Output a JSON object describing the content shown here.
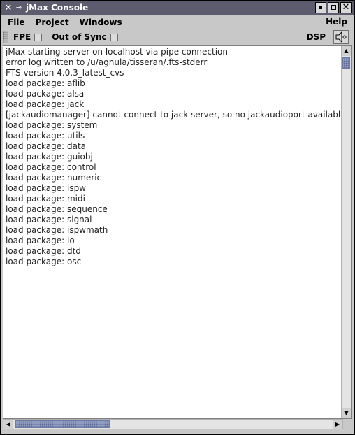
{
  "window": {
    "title": "jMax Console",
    "icons": {
      "app": "x-logo-icon",
      "pin": "pin-icon",
      "minimize": "minimize-icon",
      "maximize": "maximize-icon",
      "close": "close-icon"
    }
  },
  "menubar": {
    "items": [
      "File",
      "Project",
      "Windows"
    ],
    "help": "Help"
  },
  "toolbar": {
    "fpe_label": "FPE",
    "out_of_sync_label": "Out of Sync",
    "dsp_label": "DSP",
    "dsp_icon": "speaker-icon"
  },
  "console": {
    "lines": [
      "jMax starting server on localhost via pipe connection",
      "error log written to /u/agnula/tisseran/.fts-stderr",
      "FTS version 4.0.3_latest_cvs",
      "load package: aflib",
      "load package: alsa",
      "load package: jack",
      "[jackaudiomanager] cannot connect to jack server, so no jackaudioport available",
      "load package: system",
      "load package: utils",
      "load package: data",
      "load package: guiobj",
      "load package: control",
      "load package: numeric",
      "load package: ispw",
      "load package: midi",
      "load package: sequence",
      "load package: signal",
      "load package: ispwmath",
      "load package: io",
      "load package: dtd",
      "load package: osc"
    ]
  },
  "scrollbars": {
    "up_arrow": "▲",
    "down_arrow": "▼",
    "left_arrow": "◀",
    "right_arrow": "▶"
  }
}
